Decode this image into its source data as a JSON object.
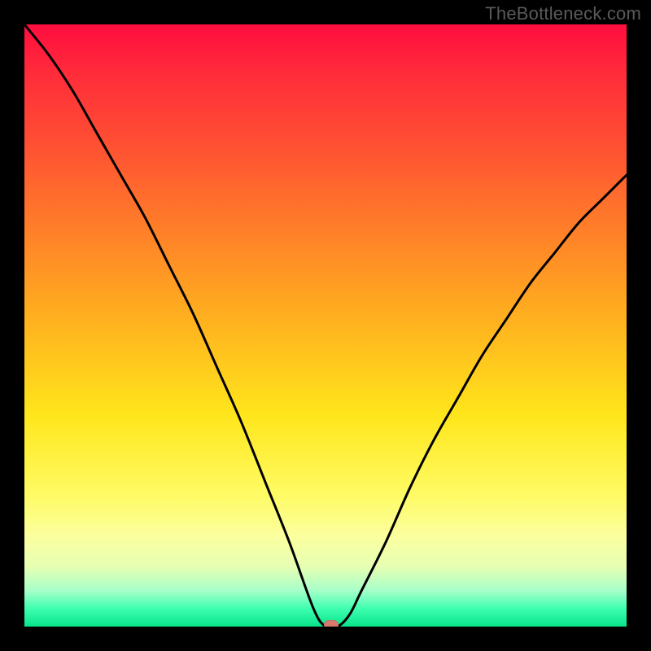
{
  "watermark": "TheBottleneck.com",
  "colors": {
    "frame": "#000000",
    "dot": "#d87a6e",
    "curve": "#000000"
  },
  "chart_data": {
    "type": "line",
    "title": "",
    "xlabel": "",
    "ylabel": "",
    "xlim": [
      0,
      100
    ],
    "ylim": [
      0,
      100
    ],
    "series": [
      {
        "name": "bottleneck-curve",
        "x": [
          0,
          4,
          8,
          12,
          16,
          20,
          24,
          28,
          32,
          36,
          40,
          44,
          48,
          50,
          52,
          54,
          56,
          60,
          64,
          68,
          72,
          76,
          80,
          84,
          88,
          92,
          96,
          100
        ],
        "values": [
          100,
          95,
          89,
          82,
          75,
          68,
          60,
          52,
          43,
          34,
          24,
          14,
          3,
          0,
          0,
          2,
          6,
          14,
          23,
          31,
          38,
          45,
          51,
          57,
          62,
          67,
          71,
          75
        ]
      }
    ],
    "marker": {
      "x": 51,
      "y": 0
    },
    "gradient_stops": [
      {
        "pct": 0,
        "color": "#ff0d3e"
      },
      {
        "pct": 50,
        "color": "#ffb41e"
      },
      {
        "pct": 85,
        "color": "#fbff9f"
      },
      {
        "pct": 100,
        "color": "#07e38a"
      }
    ]
  }
}
